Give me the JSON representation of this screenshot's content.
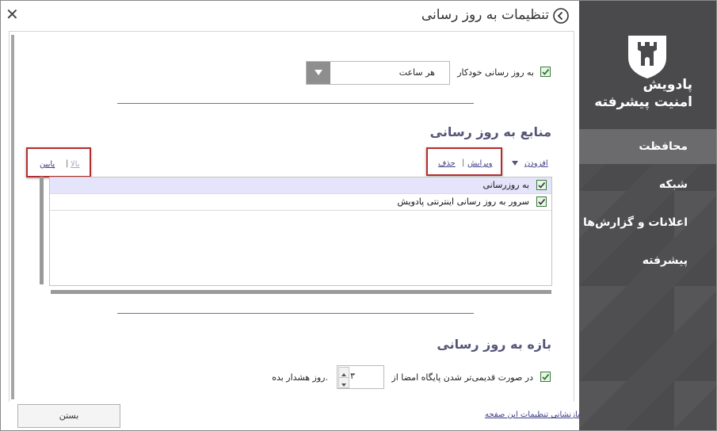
{
  "window": {
    "title": "تنظیمات به روز رسانی"
  },
  "brand": {
    "line1": "پادویش",
    "line2": "امنیت پیشرفته"
  },
  "nav": [
    {
      "label": "محافظت"
    },
    {
      "label": "شبکه"
    },
    {
      "label": "اعلانات و گزارش‌ها"
    },
    {
      "label": "پیشرفته"
    }
  ],
  "auto_update": {
    "label": "به روز رسانی خودکار",
    "value": "هر ساعت"
  },
  "sources": {
    "heading": "منابع به روز رسانی",
    "add": "افزودن",
    "edit": "ویرایش",
    "remove": "حذف",
    "up": "بالا",
    "down": "پایین",
    "rows": [
      {
        "label": "به روزرسانی"
      },
      {
        "label": "سرور به روز رسانی اینترنتی پادویش"
      }
    ]
  },
  "interval": {
    "heading": "بازه به روز رسانی",
    "prefix": "در صورت قدیمی‌تر شدن پایگاه امضا از",
    "value": "۳",
    "suffix": "روز هشدار بده."
  },
  "footer": {
    "close": "بستن",
    "reset": "بازنشانی تنظیمات این صفحه"
  },
  "colors": {
    "sidebar": "#4f4f51",
    "active_nav": "#6b6b6d",
    "highlight_border": "#b32e2e"
  }
}
